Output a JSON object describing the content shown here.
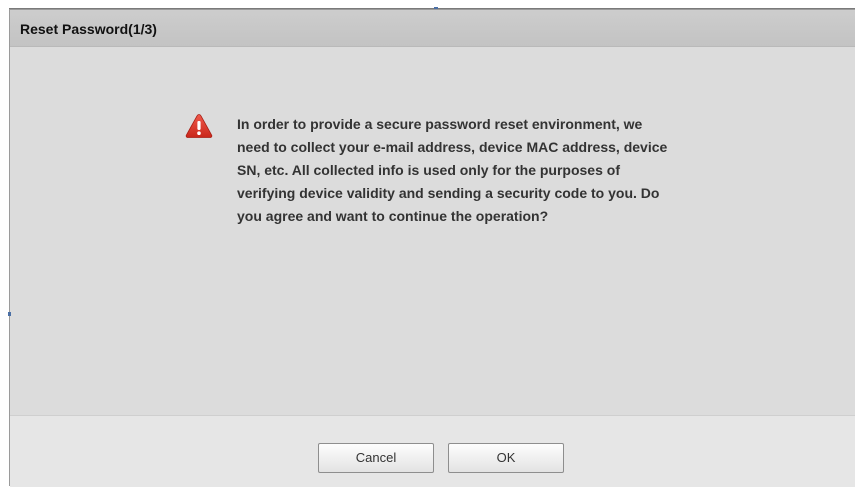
{
  "dialog": {
    "title": "Reset Password(1/3)",
    "message": "In order to provide a secure password reset environment, we need to collect your e-mail address, device MAC address, device SN, etc. All collected info is used only for the purposes of verifying device validity and sending a security code to you. Do you agree and want to continue the operation?",
    "icon": "warning-icon",
    "buttons": {
      "cancel_label": "Cancel",
      "ok_label": "OK"
    }
  },
  "colors": {
    "warning": "#e23b2e",
    "panel_bg": "#dcdcdc",
    "title_bar_bg": "#c8c8c8",
    "footer_bg": "#e6e6e6"
  }
}
